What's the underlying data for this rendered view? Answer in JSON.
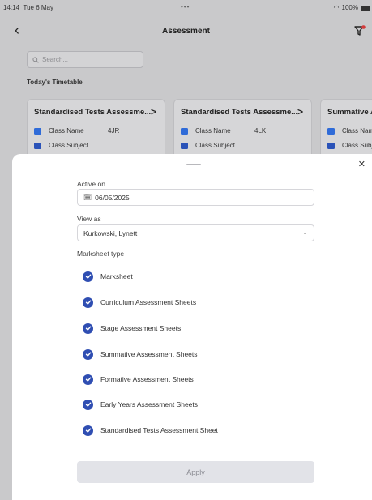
{
  "status_bar": {
    "time": "14:14",
    "date": "Tue 6 May",
    "battery": "100%"
  },
  "nav": {
    "title": "Assessment"
  },
  "search": {
    "placeholder": "Search..."
  },
  "timetable": {
    "section_title": "Today's Timetable",
    "cards": [
      {
        "title": "Standardised Tests Assessme...",
        "class_name_label": "Class Name",
        "class_name_value": "4JR",
        "class_subject_label": "Class Subject"
      },
      {
        "title": "Standardised Tests Assessme...",
        "class_name_label": "Class Name",
        "class_name_value": "4LK",
        "class_subject_label": "Class Subject"
      },
      {
        "title": "Summative A",
        "class_name_label": "Class Nam",
        "class_name_value": "",
        "class_subject_label": "Class Subj"
      }
    ]
  },
  "sheet": {
    "active_on_label": "Active on",
    "active_on_value": "06/05/2025",
    "view_as_label": "View as",
    "view_as_value": "Kurkowski, Lynett",
    "marksheet_type_label": "Marksheet type",
    "options": [
      {
        "label": "Marksheet",
        "checked": true
      },
      {
        "label": "Curriculum Assessment Sheets",
        "checked": true
      },
      {
        "label": "Stage Assessment Sheets",
        "checked": true
      },
      {
        "label": "Summative Assessment Sheets",
        "checked": true
      },
      {
        "label": "Formative Assessment Sheets",
        "checked": true
      },
      {
        "label": "Early Years Assessment Sheets",
        "checked": true
      },
      {
        "label": "Standardised Tests Assessment Sheet",
        "checked": true
      }
    ],
    "apply_label": "Apply"
  },
  "colors": {
    "accent": "#2f4eb2",
    "filter_dot": "#d23a3a",
    "class_icon": "#2f6bd8",
    "subject_icon": "#2a52b8"
  }
}
